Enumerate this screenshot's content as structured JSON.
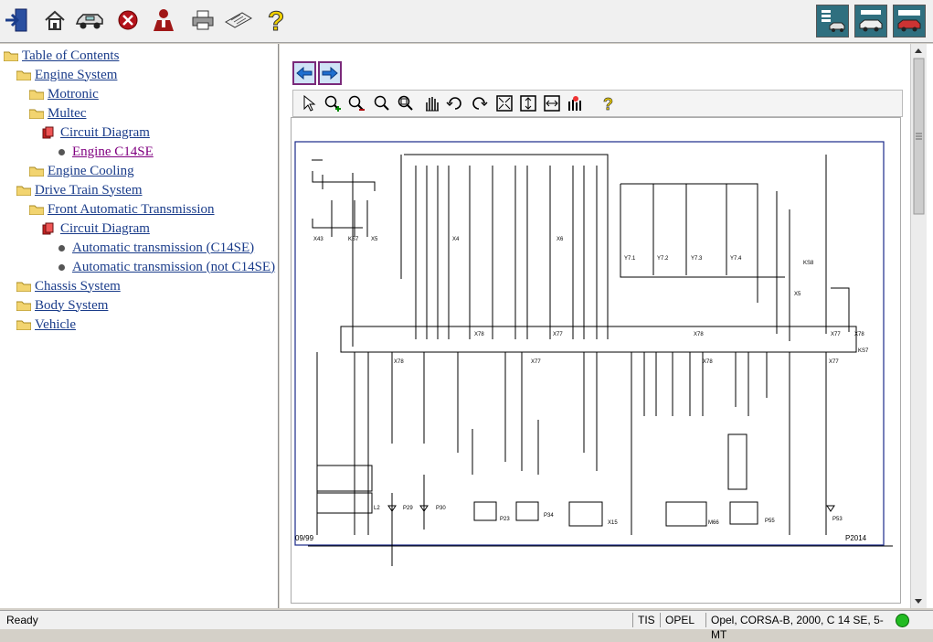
{
  "toolbar": {
    "icons": [
      "exit-icon",
      "home-icon",
      "vehicle-icon",
      "stop-icon",
      "user-icon",
      "print-icon",
      "keyboard-icon",
      "help-icon"
    ],
    "right_icons": [
      "car-list-icon",
      "car-info-icon",
      "car-select-icon"
    ]
  },
  "tree": {
    "items": [
      {
        "label": "Table of Contents"
      },
      {
        "label": "Engine System"
      },
      {
        "label": "Motronic"
      },
      {
        "label": "Multec"
      },
      {
        "label": "Circuit Diagram"
      },
      {
        "label": "Engine C14SE"
      },
      {
        "label": "Engine Cooling"
      },
      {
        "label": "Drive Train System"
      },
      {
        "label": "Front Automatic Transmission"
      },
      {
        "label": "Circuit Diagram"
      },
      {
        "label": "Automatic transmission (C14SE)"
      },
      {
        "label": "Automatic transmission (not C14SE)"
      },
      {
        "label": "Chassis System"
      },
      {
        "label": "Body System"
      },
      {
        "label": "Vehicle"
      }
    ]
  },
  "diagram": {
    "bottom_left_label": "09/99",
    "bottom_right_label": "P2014",
    "component_labels": [
      "X43",
      "KS7",
      "X5",
      "X4",
      "X6",
      "Y7.1",
      "Y7.2",
      "Y7.3",
      "Y7.4",
      "KS8",
      "X5",
      "X78",
      "X77",
      "X78",
      "X77",
      "X78",
      "KS7",
      "X78",
      "X77",
      "X78",
      "X77",
      "L2",
      "P29",
      "P30",
      "P23",
      "P34",
      "X15",
      "M66",
      "P55",
      "P53"
    ]
  },
  "status": {
    "left": "Ready",
    "tis": "TIS",
    "opel": "OPEL",
    "vehicle": "Opel, CORSA-B, 2000, C 14 SE, 5-MT"
  },
  "colors": {
    "link": "#1a3c8a",
    "visited": "#800080",
    "nav_border": "#7a2a7a",
    "diagram_line": "#000000",
    "diagram_frame": "#1a2a8a",
    "status_ok": "#22bb22"
  }
}
